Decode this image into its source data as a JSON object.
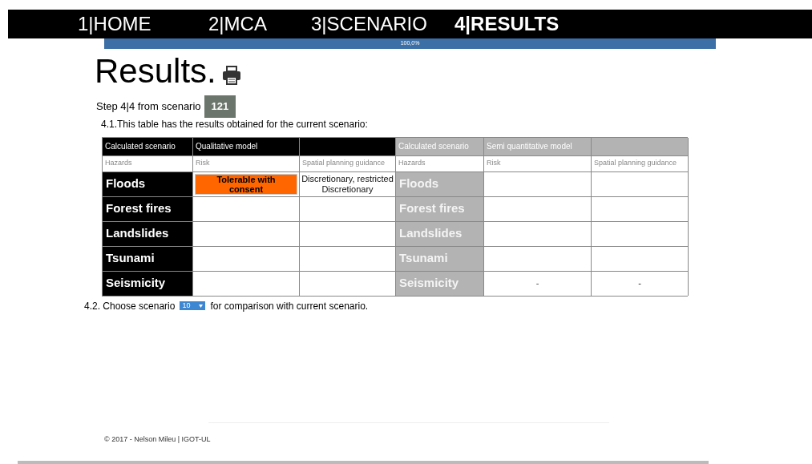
{
  "tabs": [
    {
      "label": "1|HOME",
      "selected": false
    },
    {
      "label": "2|MCA",
      "selected": false
    },
    {
      "label": "3|SCENARIO",
      "selected": false
    },
    {
      "label": "4|RESULTS",
      "selected": true
    }
  ],
  "progress": {
    "level": 1.0,
    "label": "100,0%"
  },
  "title": "Results.",
  "step": {
    "text": "Step 4|4 from scenario",
    "scenario": "121"
  },
  "intro": "4.1.This table has the results obtained for the current scenario:",
  "table_groups": [
    {
      "kind": "current",
      "headers": [
        "Calculated scenario",
        "Qualitative model"
      ],
      "columns": [
        "Hazards",
        "Risk",
        "Spatial planning guidance"
      ],
      "rows": [
        {
          "hazard": "Floods",
          "risk": "Tolerable with consent",
          "color": "#ff6600",
          "guidance": "Discretionary, restricted\nDiscretionary"
        },
        {
          "hazard": "Forest fires"
        },
        {
          "hazard": "Landslides"
        },
        {
          "hazard": "Tsunami"
        },
        {
          "hazard": "Seismicity"
        }
      ]
    },
    {
      "kind": "comparison",
      "headers": [
        "Calculated scenario",
        "Semi quantitative model"
      ],
      "columns": [
        "Hazards",
        "Risk",
        "Spatial planning guidance"
      ],
      "rows": [
        {
          "hazard": "Floods"
        },
        {
          "hazard": "Forest fires"
        },
        {
          "hazard": "Landslides"
        },
        {
          "hazard": "Tsunami"
        },
        {
          "hazard": "Seismicity",
          "risk": "-",
          "guidance": "-"
        }
      ]
    }
  ],
  "compare": {
    "before": "4.2. Choose scenario",
    "value": "10",
    "after": "for comparison with current scenario."
  },
  "footer": "© 2017 - Nelson Mileu | IGOT-UL"
}
